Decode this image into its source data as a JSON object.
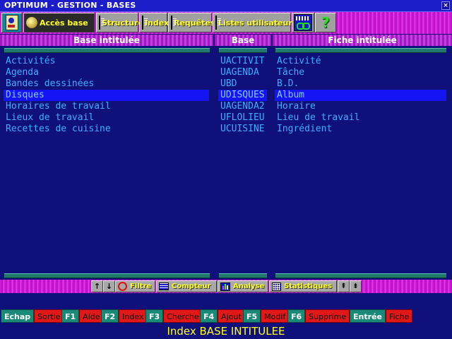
{
  "window": {
    "title": "OPTIMUM - GESTION - BASES",
    "close": "×"
  },
  "toolbar": {
    "acces_base": "Accès base",
    "structure": "Structure",
    "index": "Index",
    "requetes": "Requêtes",
    "listes": "Listes utilisateurs",
    "help": "?"
  },
  "headers": {
    "base_intitulee": "Base intitulée",
    "base": "Base",
    "fiche_intitulee": "Fiche intitulée"
  },
  "rows": [
    {
      "intitulee": "Activités",
      "base": "UACTIVIT",
      "fiche": "Activité"
    },
    {
      "intitulee": "Agenda",
      "base": "UAGENDA",
      "fiche": "Tâche"
    },
    {
      "intitulee": "Bandes dessinées",
      "base": "UBD",
      "fiche": "B.D."
    },
    {
      "intitulee": "Disques",
      "base": "UDISQUES",
      "fiche": "Album"
    },
    {
      "intitulee": "Horaires de travail",
      "base": "UAGENDA2",
      "fiche": "Horaire"
    },
    {
      "intitulee": "Lieux de travail",
      "base": "UFLOLIEU",
      "fiche": "Lieu de travail"
    },
    {
      "intitulee": "Recettes de cuisine",
      "base": "UCUISINE",
      "fiche": "Ingrédient"
    }
  ],
  "selected_row": 3,
  "bottom": {
    "filtre": "Filtre",
    "compteur": "Compteur",
    "analyse": "Analyse",
    "statistiques": "Statistiques"
  },
  "fkeys": [
    {
      "key": "Echap",
      "action": "Sortie"
    },
    {
      "key": "F1",
      "action": "Aide"
    },
    {
      "key": "F2",
      "action": "Index"
    },
    {
      "key": "F3",
      "action": "Cherche"
    },
    {
      "key": "F4",
      "action": "Ajout"
    },
    {
      "key": "F5",
      "action": "Modif"
    },
    {
      "key": "F6",
      "action": "Supprime"
    },
    {
      "key": "Entrée",
      "action": "Fiche"
    }
  ],
  "status": "Index BASE INTITULEE"
}
